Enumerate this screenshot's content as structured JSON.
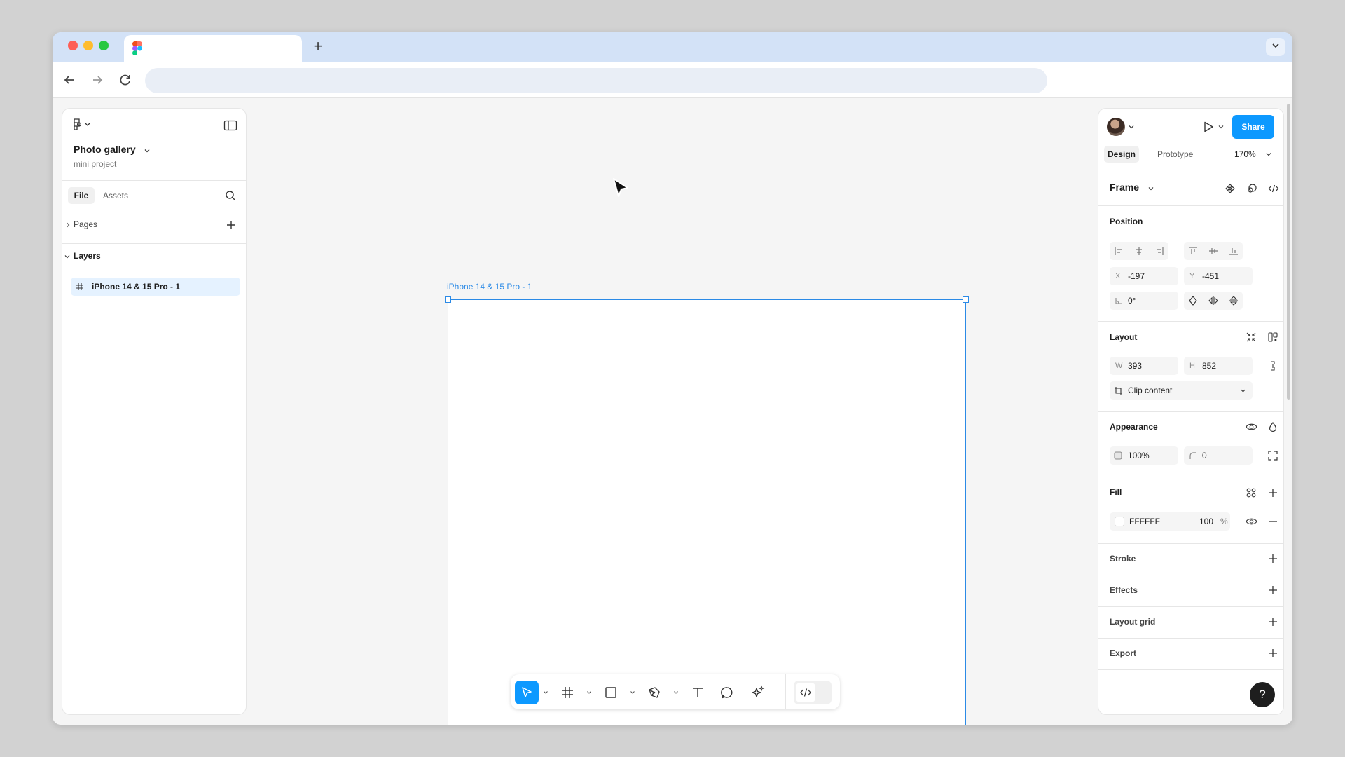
{
  "browser": {
    "new_tab": "+"
  },
  "left_panel": {
    "file_name": "Photo gallery",
    "project_name": "mini project",
    "tabs": [
      {
        "label": "File"
      },
      {
        "label": "Assets"
      }
    ],
    "pages_label": "Pages",
    "layers_label": "Layers",
    "layers": [
      {
        "label": "iPhone 14 & 15 Pro - 1"
      }
    ]
  },
  "canvas": {
    "frame_label": "iPhone 14 & 15 Pro - 1"
  },
  "right_panel": {
    "share_label": "Share",
    "tabs": [
      {
        "label": "Design"
      },
      {
        "label": "Prototype"
      }
    ],
    "zoom": "170%",
    "frame_label": "Frame",
    "position": {
      "title": "Position",
      "x_label": "X",
      "x_value": "-197",
      "y_label": "Y",
      "y_value": "-451",
      "rotation": "0°"
    },
    "layout": {
      "title": "Layout",
      "w_label": "W",
      "w_value": "393",
      "h_label": "H",
      "h_value": "852",
      "clip_label": "Clip content"
    },
    "appearance": {
      "title": "Appearance",
      "opacity": "100%",
      "radius": "0"
    },
    "fill": {
      "title": "Fill",
      "hex": "FFFFFF",
      "opacity": "100",
      "percent": "%"
    },
    "sections": [
      {
        "label": "Stroke"
      },
      {
        "label": "Effects"
      },
      {
        "label": "Layout grid"
      },
      {
        "label": "Export"
      }
    ],
    "help": "?"
  },
  "colors": {
    "accent": "#0d99ff",
    "selection": "#2b8ae6",
    "layer_highlight": "#e5f2ff"
  }
}
